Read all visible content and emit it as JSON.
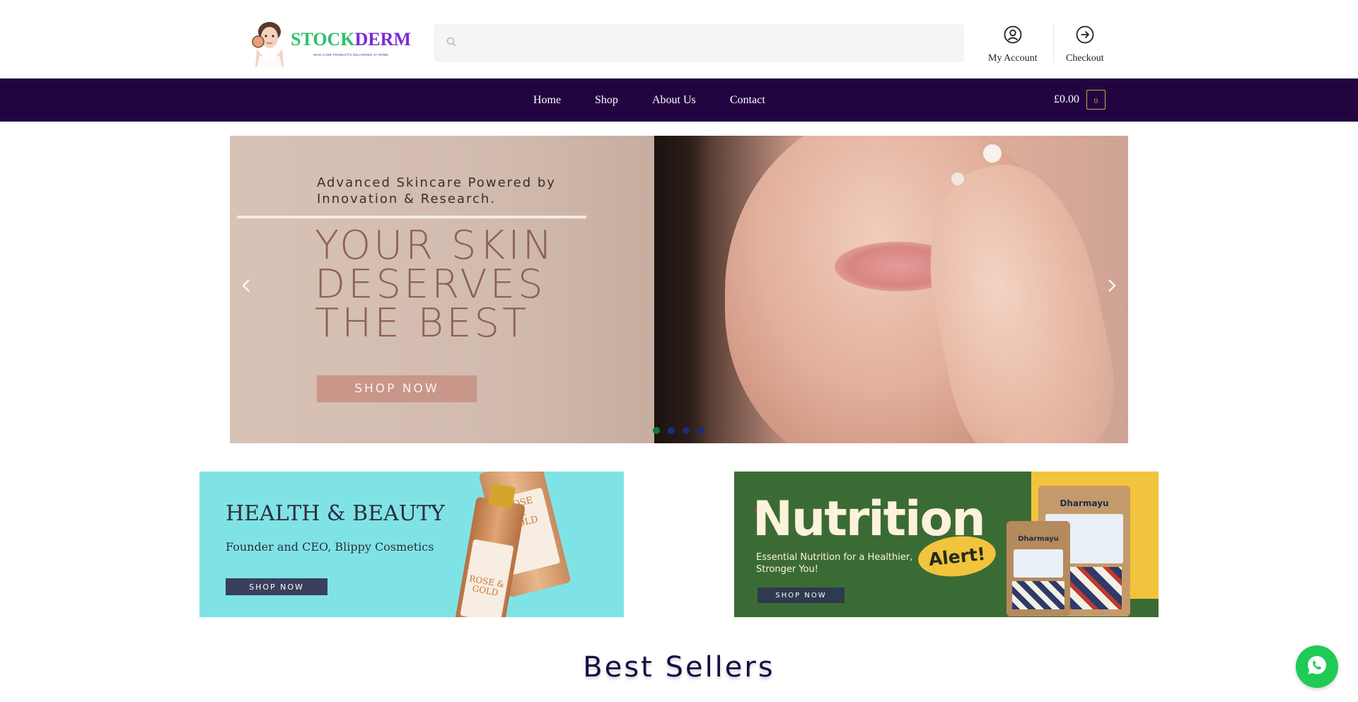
{
  "header": {
    "logo": {
      "word_part1": "STOCK",
      "word_part2": "DERM",
      "tagline": "SKIN CARE PRODUCTS DELIVERED AT HOME"
    },
    "search": {
      "placeholder": ""
    },
    "my_account_label": "My Account",
    "checkout_label": "Checkout"
  },
  "nav": {
    "items": [
      {
        "label": "Home"
      },
      {
        "label": "Shop"
      },
      {
        "label": "About Us"
      },
      {
        "label": "Contact"
      }
    ],
    "cart": {
      "total": "£0.00",
      "count": "0"
    }
  },
  "hero": {
    "subtitle": "Advanced Skincare Powered by\nInnovation & Research.",
    "title": "YOUR SKIN\nDESERVES\nTHE BEST",
    "button_label": "SHOP NOW",
    "slides": 4,
    "active_slide": 1
  },
  "promos": [
    {
      "title": "HEALTH & BEAUTY",
      "subtitle": "Founder and CEO, Blippy Cosmetics",
      "button_label": "SHOP NOW",
      "bottle_label_1": "ROSE & GOLD",
      "bottle_label_2": "ROSE & GOLD"
    },
    {
      "title": "Nutrition",
      "badge": "Alert!",
      "subtitle": "Essential Nutrition for a Healthier,\nStronger You!",
      "button_label": "SHOP NOW",
      "brand": "Dharmayu"
    }
  ],
  "best_sellers_title": "Best Sellers",
  "colors": {
    "nav_bg": "#220540",
    "cart_accent": "#c9a84a",
    "hero_button": "#c9968a",
    "promo1_bg": "#7fe3e6",
    "promo2_bg": "#3b6b35",
    "whatsapp": "#1fcb55",
    "dot_active": "#0e7a38",
    "dot_inactive": "#1d2c7a"
  }
}
